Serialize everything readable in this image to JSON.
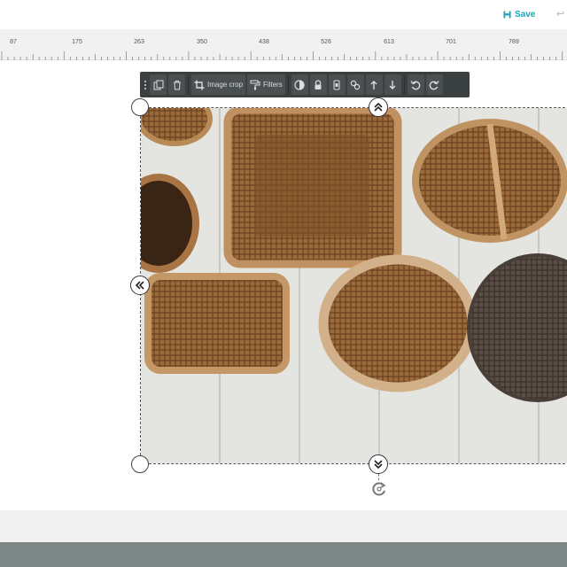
{
  "header": {
    "save_label": "Save",
    "save_icon": "floppy-disk-icon",
    "undo_icon": "undo-arrow-icon",
    "accent_color": "#1aa6b7"
  },
  "ruler": {
    "labels": [
      "87",
      "175",
      "263",
      "350",
      "438",
      "526",
      "613",
      "701",
      "789"
    ]
  },
  "toolbar": {
    "items": [
      {
        "icon": "drag-handle-icon"
      },
      {
        "icon": "duplicate-icon"
      },
      {
        "icon": "trash-icon"
      },
      {
        "icon": "crop-icon",
        "label": "Image crop"
      },
      {
        "icon": "paint-roller-icon",
        "label": "Filters"
      },
      {
        "icon": "contrast-icon"
      },
      {
        "icon": "lock-icon"
      },
      {
        "icon": "layer-icon"
      },
      {
        "icon": "link-icon"
      },
      {
        "icon": "bring-forward-icon"
      },
      {
        "icon": "send-backward-icon"
      },
      {
        "icon": "rotate-left-icon"
      },
      {
        "icon": "rotate-right-icon"
      }
    ],
    "background": "#3a3f3f"
  },
  "image": {
    "subject": "wicker baskets on white wooden floor"
  },
  "colors": {
    "footer": "#7d8785",
    "ruler_bg": "#f1f1f1"
  }
}
